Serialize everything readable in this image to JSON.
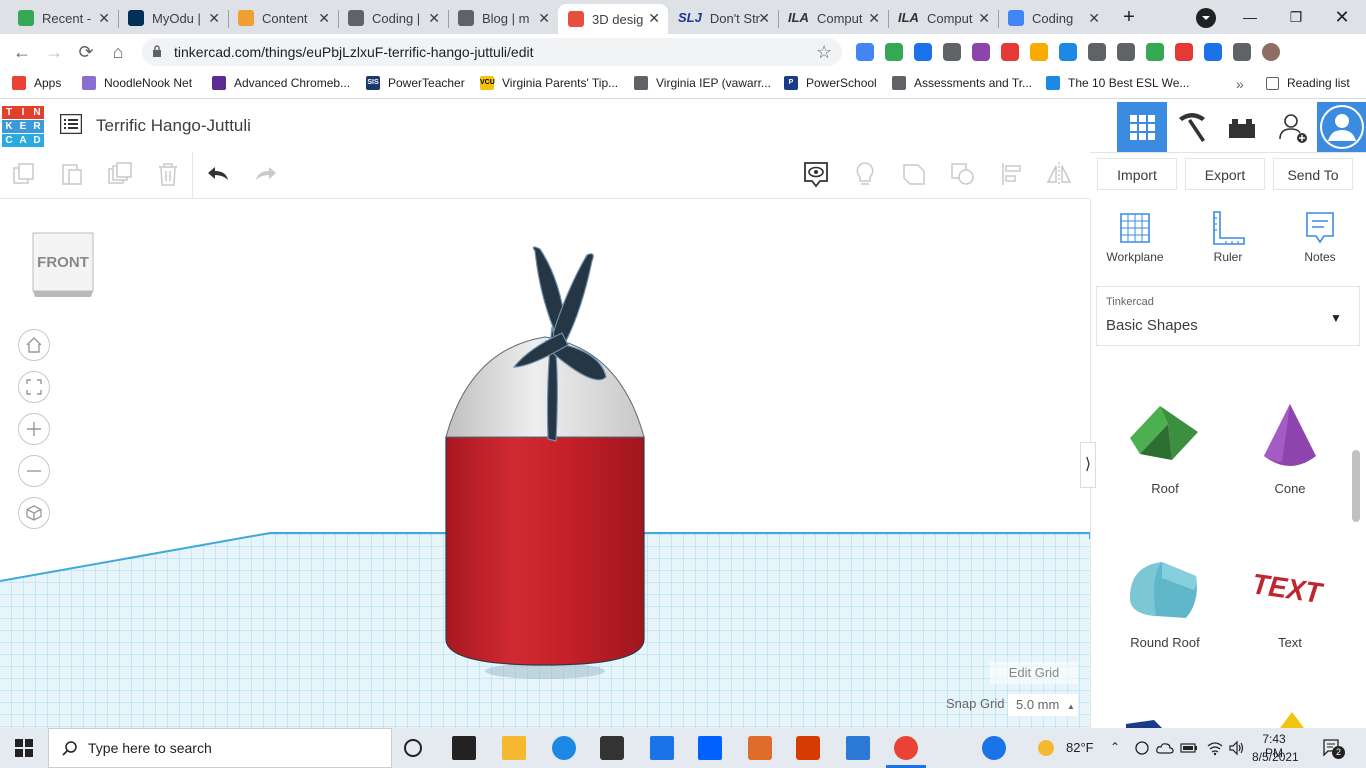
{
  "browser": {
    "tabs": [
      {
        "title": "Recent -",
        "favicon_color": "#34a853"
      },
      {
        "title": "MyOdu |",
        "favicon_color": "#003057"
      },
      {
        "title": "Content",
        "favicon_color": "#f0a030"
      },
      {
        "title": "Coding |",
        "favicon_color": "#5f6368"
      },
      {
        "title": "Blog | m",
        "favicon_color": "#5f6368"
      },
      {
        "title": "3D desig",
        "favicon_color": "#e84e3f"
      },
      {
        "title": "Don't Str",
        "favicon_color": "#1a3a8a"
      },
      {
        "title": "Comput",
        "favicon_color": "#333333"
      },
      {
        "title": "Comput",
        "favicon_color": "#333333"
      },
      {
        "title": "Coding",
        "favicon_color": "#4285f4"
      }
    ],
    "tab_prefixes": [
      "",
      "",
      "",
      "",
      "",
      "",
      "SLJ",
      "ILA",
      "ILA",
      ""
    ],
    "active_tab_index": 5,
    "url": "tinkercad.com/things/euPbjLzlxuF-terrific-hango-juttuli/edit",
    "bookmarks": [
      {
        "label": "Apps",
        "color": "#ea4335"
      },
      {
        "label": "NoodleNook Net",
        "color": "#8a6fd1"
      },
      {
        "label": "Advanced Chromeb...",
        "color": "#5c2d91"
      },
      {
        "label": "PowerTeacher",
        "color": "#1a3a6b"
      },
      {
        "label": "Virginia Parents' Tip...",
        "color": "#f4c20d"
      },
      {
        "label": "Virginia IEP (vawarr...",
        "color": "#5f6368"
      },
      {
        "label": "PowerSchool",
        "color": "#1a3a8a"
      },
      {
        "label": "Assessments and Tr...",
        "color": "#5f6368"
      },
      {
        "label": "The 10 Best ESL We...",
        "color": "#1e88e5"
      }
    ],
    "bookmark_badges": [
      "",
      "",
      "",
      "SIS",
      "VCU",
      "",
      "P",
      "",
      ""
    ],
    "bookmarks_more": "»",
    "reading_list": "Reading list"
  },
  "tinkercad": {
    "design_title": "Terrific Hango-Juttuli",
    "logo_letters": [
      "T",
      "I",
      "N",
      "K",
      "E",
      "R",
      "C",
      "A",
      "D"
    ],
    "logo_colors": [
      "#e2402b",
      "#e2402b",
      "#e2402b",
      "#3b9ad9",
      "#3b9ad9",
      "#3b9ad9",
      "#29abe2",
      "#29abe2",
      "#29abe2"
    ],
    "import_label": "Import",
    "export_label": "Export",
    "send_to_label": "Send To",
    "front_label": "FRONT",
    "edit_grid_label": "Edit Grid",
    "snap_grid_label": "Snap Grid",
    "snap_grid_value": "5.0 mm",
    "panel_tools": [
      "Workplane",
      "Ruler",
      "Notes"
    ],
    "library_source": "Tinkercad",
    "library_name": "Basic Shapes",
    "shapes": [
      "Roof",
      "Cone",
      "Round Roof",
      "Text"
    ],
    "model_colors": {
      "body": "#c8212b",
      "dome": "#d7d7d7",
      "blades": "#253645",
      "grid": "#6ecbe8",
      "workplane": "#e9f6fc"
    },
    "accent_color": "#3b8be0"
  },
  "taskbar": {
    "search_placeholder": "Type here to search",
    "temperature": "82°F",
    "time": "7:43 PM",
    "date": "8/5/2021",
    "notifications": "2"
  }
}
